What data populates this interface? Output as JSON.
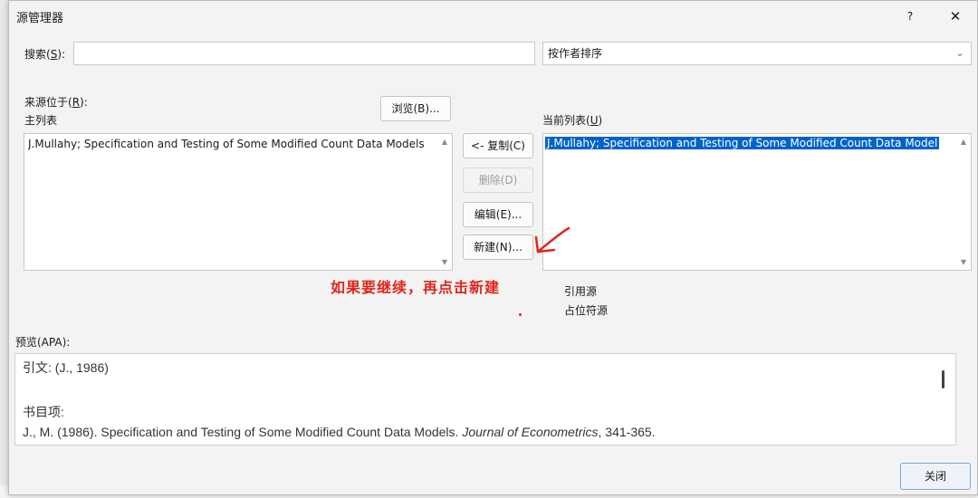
{
  "window": {
    "title": "源管理器",
    "help": "?",
    "close": "✕"
  },
  "search": {
    "label": "搜索(",
    "key": "S",
    "suffix": "):",
    "value": ""
  },
  "sort": {
    "selected": "按作者排序"
  },
  "source_location": {
    "label": "来源位于(",
    "key": "R",
    "suffix": "):"
  },
  "browse_button": "浏览(B)...",
  "master_list": {
    "label": "主列表",
    "items": [
      "J.Mullahy; Specification and Testing of Some Modified Count Data Models"
    ]
  },
  "current_list": {
    "label": "当前列表(",
    "key": "U",
    "suffix": ")",
    "items": [
      "J.Mullahy; Specification and Testing of Some Modified Count Data Model"
    ]
  },
  "buttons": {
    "copy": "<- 复制(C)",
    "delete": "删除(D)",
    "edit": "编辑(E)...",
    "new": "新建(N)..."
  },
  "legend": {
    "cited": "引用源",
    "placeholder": "占位符源"
  },
  "annotation": {
    "text": "如果要继续，再点击新建",
    "color": "#e0261b"
  },
  "preview": {
    "label": "预览(APA):",
    "citation": "引文:   (J., 1986)",
    "bib_label": "书目项:",
    "bib_main": "J., M. (1986). Specification and Testing of Some Modified Count Data Models. ",
    "bib_journal": "Journal of Econometrics",
    "bib_pages": ", 341-365."
  },
  "close_button": "关闭",
  "colors": {
    "selection": "#0063c9",
    "accent": "#e0261b"
  }
}
